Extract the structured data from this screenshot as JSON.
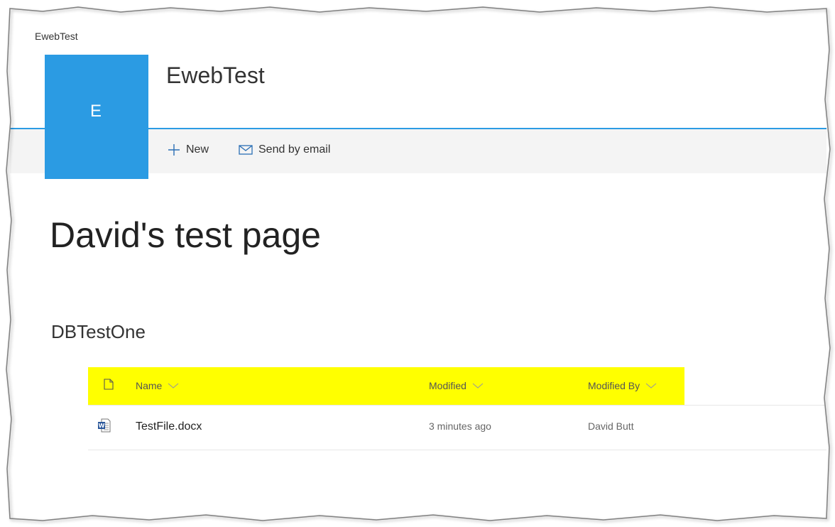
{
  "breadcrumb": "EwebTest",
  "site": {
    "logo_letter": "E",
    "title": "EwebTest",
    "accent": "#2b9be3"
  },
  "commands": {
    "new_label": "New",
    "new_icon": "plus-icon",
    "email_label": "Send by email",
    "email_icon": "mail-icon"
  },
  "page_title": "David's test page",
  "library": {
    "title": "DBTestOne",
    "highlight_color": "#ffff00",
    "columns": [
      {
        "label": "Name"
      },
      {
        "label": "Modified"
      },
      {
        "label": "Modified By"
      }
    ],
    "rows": [
      {
        "name": "TestFile.docx",
        "modified": "3 minutes ago",
        "modified_by": "David Butt",
        "icon": "word-doc-icon"
      }
    ]
  }
}
